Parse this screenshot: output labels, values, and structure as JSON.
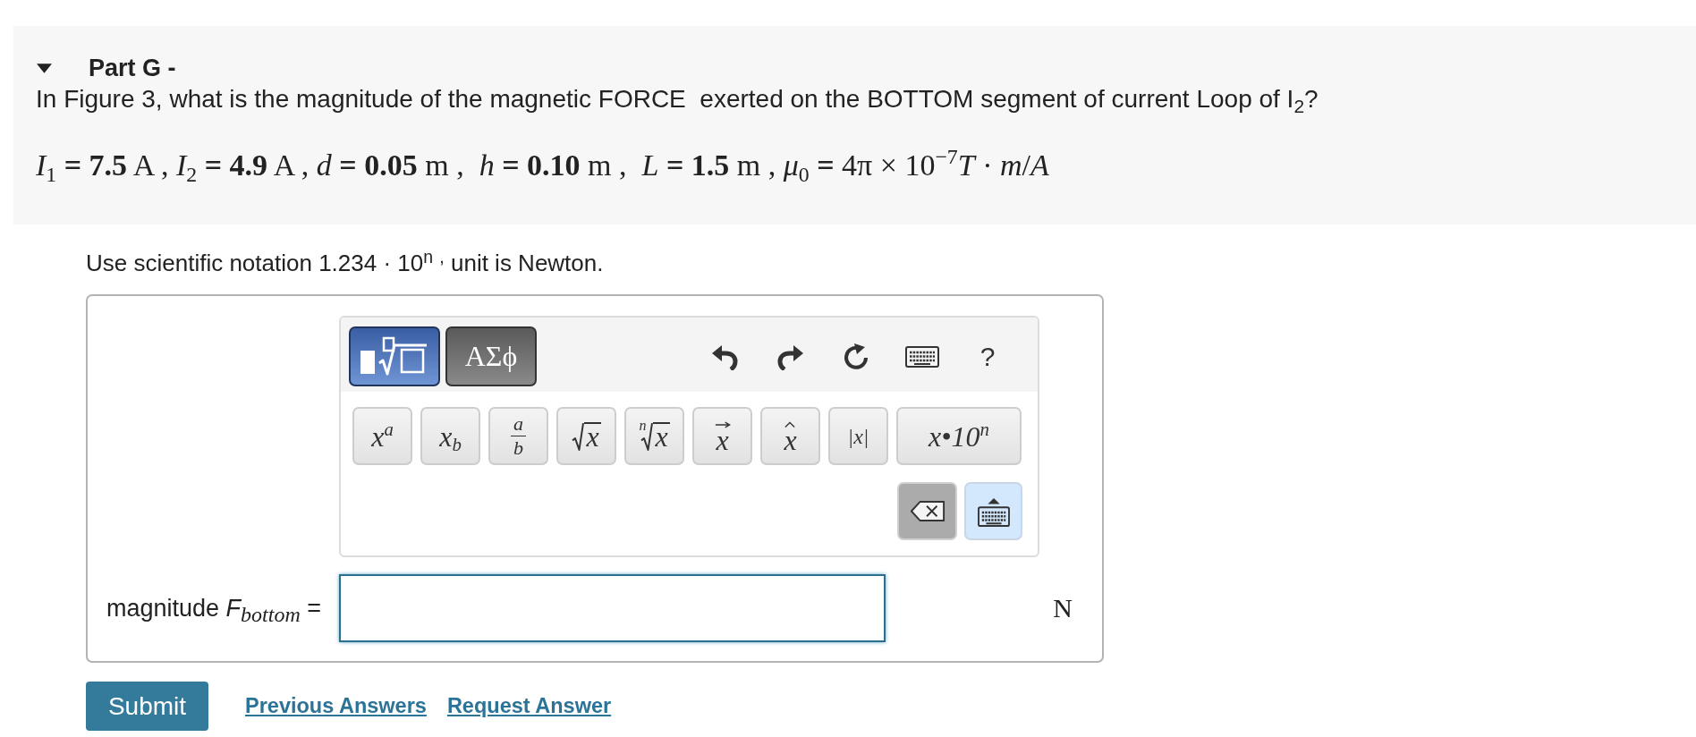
{
  "part": {
    "expanded": true,
    "title": "Part G -",
    "question": "In Figure 3, what is the magnitude of the magnetic FORCE  exerted on the BOTTOM segment of current Loop of I$_{2}$?",
    "given": "*I*$_{1}$ **= 7.5** A , *I*$_{2}$ **= 4.9** A , *d* **= 0.05** m ,  *h* **= 0.10** m ,  *L* **= 1.5** m , *μ*$_{0}$ **=** 4π × 10$^{−7}$*T* · *m*/*A*"
  },
  "answer": {
    "hint": "Use scientific notation 1.234 · 10$^{n}$ $^{,}$ unit is Newton.",
    "toolbar": {
      "modes": [
        {
          "kind": "templates",
          "selected": true
        },
        {
          "kind": "symbols",
          "label": "ΑΣϕ",
          "selected": false
        }
      ],
      "tools": [
        {
          "kind": "undo"
        },
        {
          "kind": "redo"
        },
        {
          "kind": "reset"
        },
        {
          "kind": "keyboard"
        },
        {
          "kind": "help",
          "label": "?"
        }
      ],
      "keys": [
        {
          "kind": "power",
          "label": "x$^{a}$"
        },
        {
          "kind": "subscript",
          "label": "x$_{b}$"
        },
        {
          "kind": "fraction",
          "numerator": "a",
          "denominator": "b"
        },
        {
          "kind": "root",
          "radicand": "x"
        },
        {
          "kind": "root",
          "index": "n",
          "radicand": "x"
        },
        {
          "kind": "vector",
          "label": "x"
        },
        {
          "kind": "unit_vector",
          "label": "x"
        },
        {
          "kind": "abs",
          "label": "|*x*|"
        },
        {
          "kind": "sci",
          "label": "x•10$^{n}$"
        }
      ],
      "bottom_keys": [
        {
          "kind": "backspace"
        },
        {
          "kind": "keyboard_toggle"
        }
      ]
    },
    "label": "magnitude *F*$_{bottom}$ =",
    "input": {
      "focused": true
    },
    "unit": "N"
  },
  "actions": {
    "submit": "Submit",
    "links": [
      "Previous Answers",
      "Request Answer"
    ]
  }
}
